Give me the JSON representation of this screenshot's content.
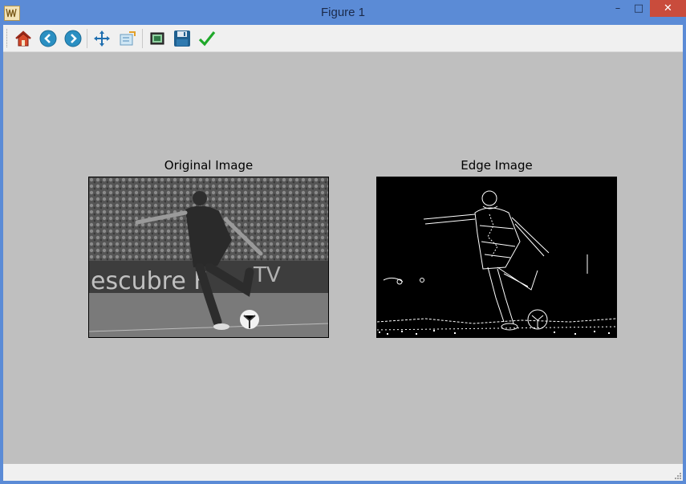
{
  "window": {
    "title": "Figure 1"
  },
  "toolbar": {
    "buttons": [
      {
        "name": "home-button",
        "icon": "home-icon"
      },
      {
        "name": "back-button",
        "icon": "arrow-left-icon"
      },
      {
        "name": "forward-button",
        "icon": "arrow-right-icon"
      },
      {
        "name": "pan-button",
        "icon": "move-icon"
      },
      {
        "name": "zoom-button",
        "icon": "zoom-rect-icon"
      },
      {
        "name": "subplots-button",
        "icon": "subplots-icon"
      },
      {
        "name": "save-button",
        "icon": "floppy-disk-icon"
      },
      {
        "name": "edit-button",
        "icon": "check-icon"
      }
    ]
  },
  "figure": {
    "axes": [
      {
        "title": "Original Image",
        "image": "grayscale photo of soccer player kicking a ball"
      },
      {
        "title": "Edge Image",
        "image": "edge-detected version, white edges on black"
      }
    ]
  },
  "colors": {
    "titlebar": "#5b8bd6",
    "figure_bg": "#bfbfbf",
    "close": "#c94c3c"
  }
}
